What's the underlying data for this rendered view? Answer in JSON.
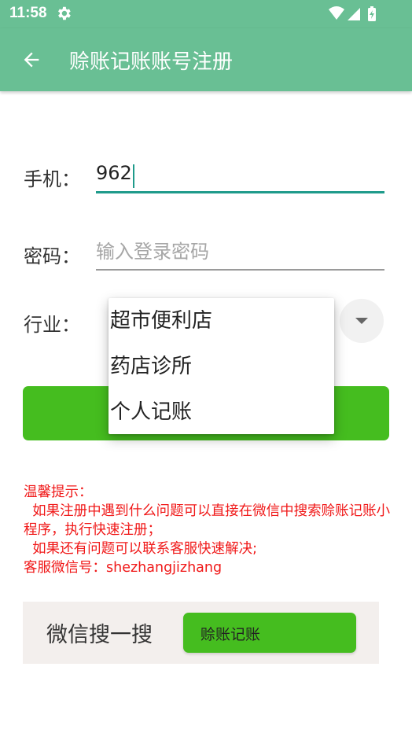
{
  "status_bar": {
    "time": "11:58",
    "settings_icon": "gear-icon",
    "wifi_icon": "wifi-icon",
    "signal_icon": "signal-icon",
    "battery_icon": "battery-charging-icon"
  },
  "app_bar": {
    "back_icon": "arrow-back-icon",
    "title": "赊账记账账号注册"
  },
  "form": {
    "phone": {
      "label": "手机：",
      "value": "962"
    },
    "password": {
      "label": "密码：",
      "placeholder": "输入登录密码"
    },
    "industry": {
      "label": "行业："
    }
  },
  "industry_dropdown": {
    "options": [
      "超市便利店",
      "药店诊所",
      "个人记账"
    ]
  },
  "tips": {
    "line1": "温馨提示：",
    "line2": "  如果注册中遇到什么问题可以直接在微信中搜索赊账记账小程序，执行快速注册；",
    "line3": "  如果还有问题可以联系客服快速解决;",
    "line4": "客服微信号：shezhangjizhang"
  },
  "wechat_search": {
    "label": "微信搜一搜",
    "button_label": "赊账记账"
  },
  "colors": {
    "app_bar": "#69bf94",
    "primary_button": "#45bd1f",
    "tip_text": "#f01818",
    "active_underline": "#1f9b8b"
  }
}
